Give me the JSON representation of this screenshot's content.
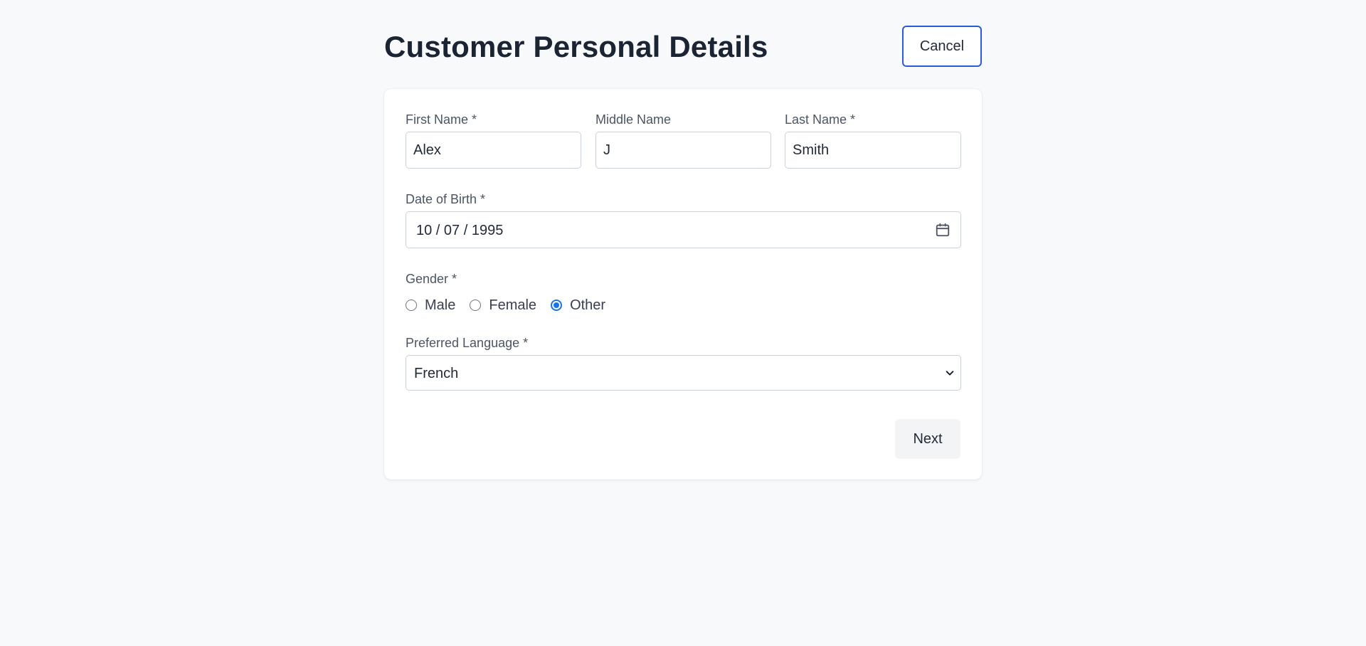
{
  "page": {
    "title": "Customer Personal Details"
  },
  "header": {
    "cancel_label": "Cancel"
  },
  "form": {
    "first_name": {
      "label": "First Name *",
      "value": "Alex"
    },
    "middle_name": {
      "label": "Middle Name",
      "value": "J"
    },
    "last_name": {
      "label": "Last Name *",
      "value": "Smith"
    },
    "date_of_birth": {
      "label": "Date of Birth *",
      "value": "10 / 07 / 1995",
      "icon": "calendar-icon"
    },
    "gender": {
      "label": "Gender *",
      "options": [
        {
          "label": "Male",
          "checked": false
        },
        {
          "label": "Female",
          "checked": false
        },
        {
          "label": "Other",
          "checked": true
        }
      ]
    },
    "preferred_language": {
      "label": "Preferred Language *",
      "selected": "French",
      "icon": "chevron-down-icon"
    },
    "next_label": "Next"
  },
  "colors": {
    "background": "#f8f9fb",
    "accent": "#1a73e8",
    "cancel_border": "#2a5bd7",
    "title": "#1b2433"
  }
}
